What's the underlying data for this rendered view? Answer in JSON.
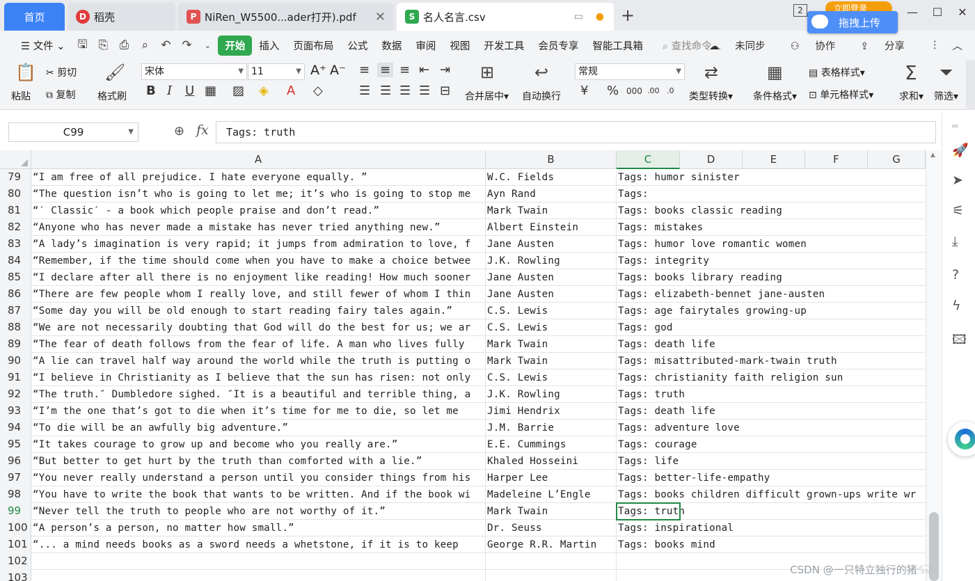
{
  "tabs": [
    {
      "label": "首页"
    },
    {
      "label": "稻壳"
    },
    {
      "label": "NiRen_W5500...ader打开).pdf"
    },
    {
      "label": "名人名言.csv"
    }
  ],
  "window": {
    "page_badge": "2",
    "login": "立即登录",
    "upload": "拖拽上传"
  },
  "menu": {
    "file": "文件",
    "items": [
      "开始",
      "插入",
      "页面布局",
      "公式",
      "数据",
      "审阅",
      "视图",
      "开发工具",
      "会员专享",
      "智能工具箱"
    ],
    "search": "查找命令...",
    "sync": "未同步",
    "collab": "协作",
    "share": "分享"
  },
  "ribbon": {
    "paste": "粘贴",
    "cut": "剪切",
    "copy": "复制",
    "format_painter": "格式刷",
    "font_name": "宋体",
    "font_size": "11",
    "merge": "合并居中",
    "wrap": "自动换行",
    "number_format": "常规",
    "type_convert": "类型转换",
    "cond_format": "条件格式",
    "table_style": "表格样式",
    "cell_style": "单元格样式",
    "sum": "求和",
    "filter": "筛选"
  },
  "formula_bar": {
    "cell_ref": "C99",
    "fx": "fx",
    "content": "Tags: truth"
  },
  "columns": [
    "A",
    "B",
    "C",
    "D",
    "E",
    "F",
    "G"
  ],
  "selected": {
    "column": "C",
    "row": "99"
  },
  "rows": [
    {
      "num": "79",
      "a": "“I am free of all prejudice. I hate everyone equally. ”",
      "b": "W.C. Fields",
      "c": "Tags: humor sinister"
    },
    {
      "num": "80",
      "a": "“The question isn’t who is going to let me; it’s who is going to stop me",
      "b": "Ayn Rand",
      "c": "Tags:"
    },
    {
      "num": "81",
      "a": "“′ Classic′  - a book which people praise and don’t read.”",
      "b": "Mark Twain",
      "c": "Tags: books classic reading"
    },
    {
      "num": "82",
      "a": "“Anyone who has never made a mistake has never tried anything new.”",
      "b": "Albert Einstein",
      "c": "Tags: mistakes"
    },
    {
      "num": "83",
      "a": "“A lady’s imagination is very rapid; it jumps from admiration to love, f",
      "b": "Jane Austen",
      "c": "Tags: humor love romantic women"
    },
    {
      "num": "84",
      "a": "“Remember, if the time should come when you have to make a choice betwee",
      "b": "J.K. Rowling",
      "c": "Tags: integrity"
    },
    {
      "num": "85",
      "a": "“I declare after all there is no enjoyment like reading! How much sooner",
      "b": "Jane Austen",
      "c": "Tags: books library reading"
    },
    {
      "num": "86",
      "a": "“There are few people whom I really love, and still fewer of whom I thin",
      "b": "Jane Austen",
      "c": "Tags: elizabeth-bennet jane-austen"
    },
    {
      "num": "87",
      "a": "“Some day you will be old enough to start reading fairy tales again.”",
      "b": "C.S. Lewis",
      "c": "Tags: age fairytales growing-up"
    },
    {
      "num": "88",
      "a": "“We are not necessarily doubting that God will do the best for us; we ar",
      "b": "C.S. Lewis",
      "c": "Tags: god"
    },
    {
      "num": "89",
      "a": "“The fear of death follows from the fear of life. A man who lives fully",
      "b": "Mark Twain",
      "c": "Tags: death life"
    },
    {
      "num": "90",
      "a": "“A lie can travel half way around the world while the truth is putting o",
      "b": "Mark Twain",
      "c": "Tags: misattributed-mark-twain truth"
    },
    {
      "num": "91",
      "a": "“I believe in Christianity as I believe that the sun has risen: not only",
      "b": "C.S. Lewis",
      "c": "Tags: christianity faith religion sun"
    },
    {
      "num": "92",
      "a": "“The truth.″ Dumbledore sighed. ″It is a beautiful and terrible thing, a",
      "b": "J.K. Rowling",
      "c": "Tags: truth"
    },
    {
      "num": "93",
      "a": "“I’m the one that’s got to die when it’s time for me to die, so let me",
      "b": "Jimi Hendrix",
      "c": "Tags: death life"
    },
    {
      "num": "94",
      "a": "“To die will be an awfully big adventure.”",
      "b": "J.M. Barrie",
      "c": "Tags: adventure love"
    },
    {
      "num": "95",
      "a": "“It takes courage to grow up and become who you really are.”",
      "b": "E.E. Cummings",
      "c": "Tags: courage"
    },
    {
      "num": "96",
      "a": "“But better to get hurt by the truth than comforted with a lie.”",
      "b": "Khaled Hosseini",
      "c": "Tags: life"
    },
    {
      "num": "97",
      "a": "“You never really understand a person until you consider things from his",
      "b": "Harper Lee",
      "c": "Tags: better-life-empathy"
    },
    {
      "num": "98",
      "a": "“You have to write the book that wants to be written. And if the book wi",
      "b": "Madeleine L’Engle",
      "c": "Tags: books children difficult grown-ups write wr"
    },
    {
      "num": "99",
      "a": "“Never tell the truth to people who are not worthy of it.”",
      "b": "Mark Twain",
      "c": "Tags: truth"
    },
    {
      "num": "100",
      "a": "“A person’s a person, no matter how small.”",
      "b": "Dr. Seuss",
      "c": "Tags: inspirational"
    },
    {
      "num": "101",
      "a": "“... a mind needs books as a sword needs a whetstone, if it is to keep",
      "b": "George R.R. Martin",
      "c": "Tags: books mind"
    },
    {
      "num": "102",
      "a": "",
      "b": "",
      "c": ""
    },
    {
      "num": "103",
      "a": "",
      "b": "",
      "c": ""
    }
  ],
  "watermark": "CSDN @一只特立独行的猪𓃟",
  "colors": {
    "accent_green": "#1f8a44",
    "home_tab_blue": "#3b82f6",
    "start_tab_green": "#2fa84f"
  }
}
